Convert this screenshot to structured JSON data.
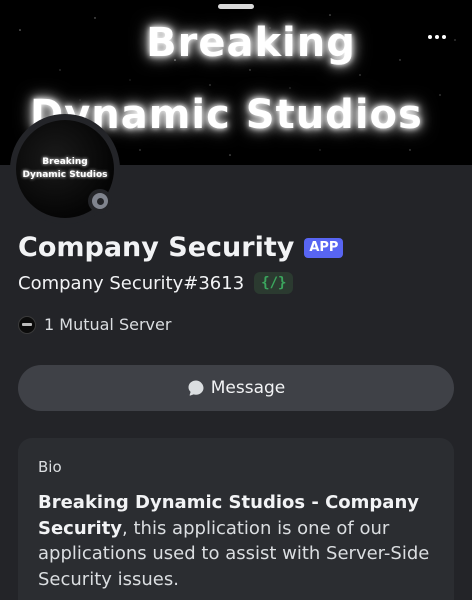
{
  "banner": {
    "line1": "Breaking",
    "line2": "Dynamic Studios"
  },
  "avatar": {
    "line1": "Breaking",
    "line2": "Dynamic Studios",
    "status": "offline"
  },
  "profile": {
    "display_name": "Company Security",
    "badge": "APP",
    "username": "Company Security#3613",
    "code_badge": "{/}"
  },
  "mutual": {
    "label": "1 Mutual Server"
  },
  "actions": {
    "message_label": "Message"
  },
  "bio": {
    "heading": "Bio",
    "bold_text": "Breaking Dynamic Studios - Company Security",
    "rest_text": ", this application is one of our applications used to assist with Server-Side Security issues."
  },
  "colors": {
    "background": "#232428",
    "card": "#2b2d31",
    "button": "#3f4147",
    "badge_blurple": "#5865f2",
    "code_green": "#3ba55d"
  }
}
